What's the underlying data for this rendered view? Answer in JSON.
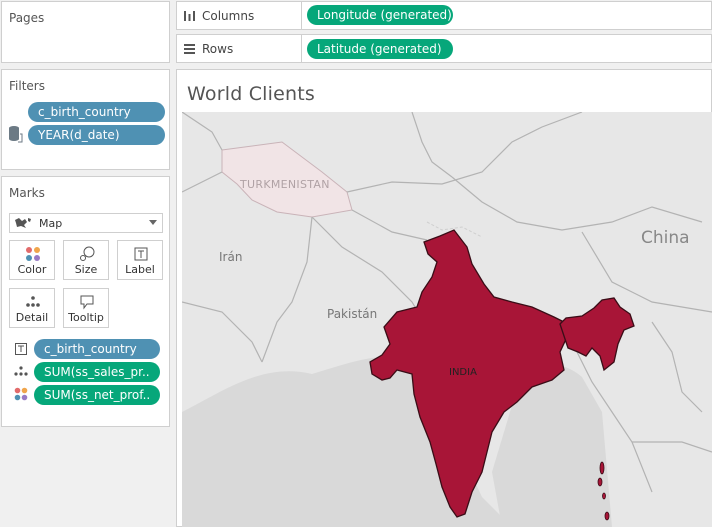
{
  "pages": {
    "title": "Pages"
  },
  "filters": {
    "title": "Filters",
    "items": [
      "c_birth_country",
      "YEAR(d_date)"
    ]
  },
  "marks": {
    "title": "Marks",
    "type": "Map",
    "buttons": {
      "color": "Color",
      "size": "Size",
      "label": "Label",
      "detail": "Detail",
      "tooltip": "Tooltip"
    },
    "fields": [
      "c_birth_country",
      "SUM(ss_sales_pr..",
      "SUM(ss_net_prof.."
    ]
  },
  "shelves": {
    "columns_label": "Columns",
    "columns_pill": "Longitude (generated)",
    "rows_label": "Rows",
    "rows_pill": "Latitude (generated)"
  },
  "view": {
    "title": "World Clients",
    "labels": {
      "turkmenistan": "TURKMENISTAN",
      "iran": "Irán",
      "pakistan": "Pakistán",
      "china": "China",
      "india": "INDIA"
    },
    "highlight_color": "#a81537"
  }
}
